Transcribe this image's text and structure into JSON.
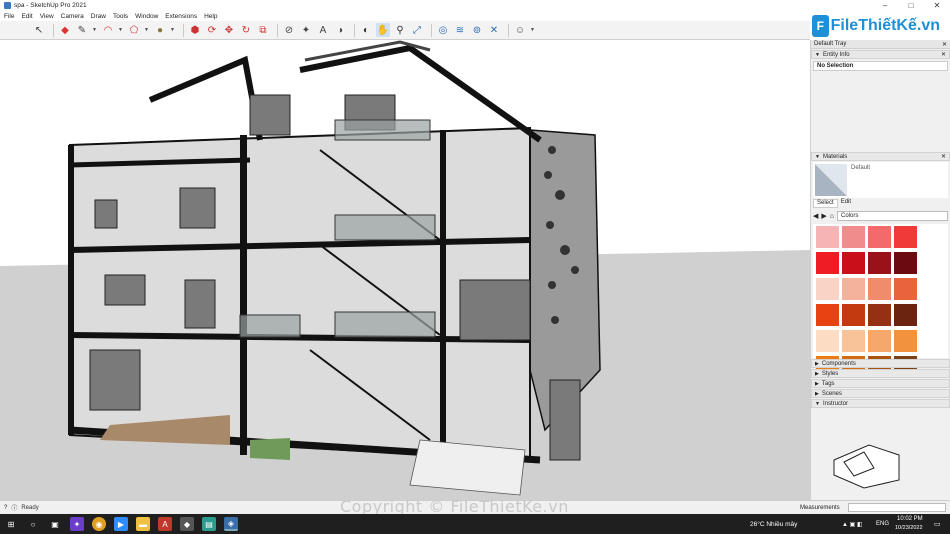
{
  "window": {
    "title": "spa - SketchUp Pro 2021"
  },
  "menu": [
    "File",
    "Edit",
    "View",
    "Camera",
    "Draw",
    "Tools",
    "Window",
    "Extensions",
    "Help"
  ],
  "logo": {
    "text": "FileThiếtKế.vn",
    "badge": "F"
  },
  "tray": {
    "title": "Default Tray",
    "entity_info": {
      "header": "Entity Info",
      "selection": "No Selection"
    },
    "materials": {
      "header": "Materials",
      "current": "Default",
      "tabs": [
        "Select",
        "Edit"
      ],
      "library": "Colors",
      "swatches": [
        "#f6b4b4",
        "#f08c8c",
        "#f46a6a",
        "#f03a3a",
        "#ef1c24",
        "#c80f1a",
        "#9a1219",
        "#6b0a0f",
        "#f9d3c6",
        "#f4b29c",
        "#f08c6c",
        "#e9643c",
        "#e84212",
        "#c33a10",
        "#953012",
        "#6a2410",
        "#fcdcc2",
        "#f9c39a",
        "#f6a86c",
        "#f3923c",
        "#f07a12",
        "#d36c12",
        "#a95612",
        "#7d4010"
      ]
    },
    "collapsed_panels": [
      "Components",
      "Styles",
      "Tags",
      "Scenes"
    ],
    "instructor": {
      "header": "Instructor"
    }
  },
  "status": {
    "ready": "Ready",
    "measurements_label": "Measurements"
  },
  "watermark": "Copyright © FileThietKe.vn",
  "taskbar": {
    "weather": "26°C  Nhiều mây",
    "lang": "ENG",
    "time": "10:02 PM",
    "date": "10/23/2022"
  }
}
